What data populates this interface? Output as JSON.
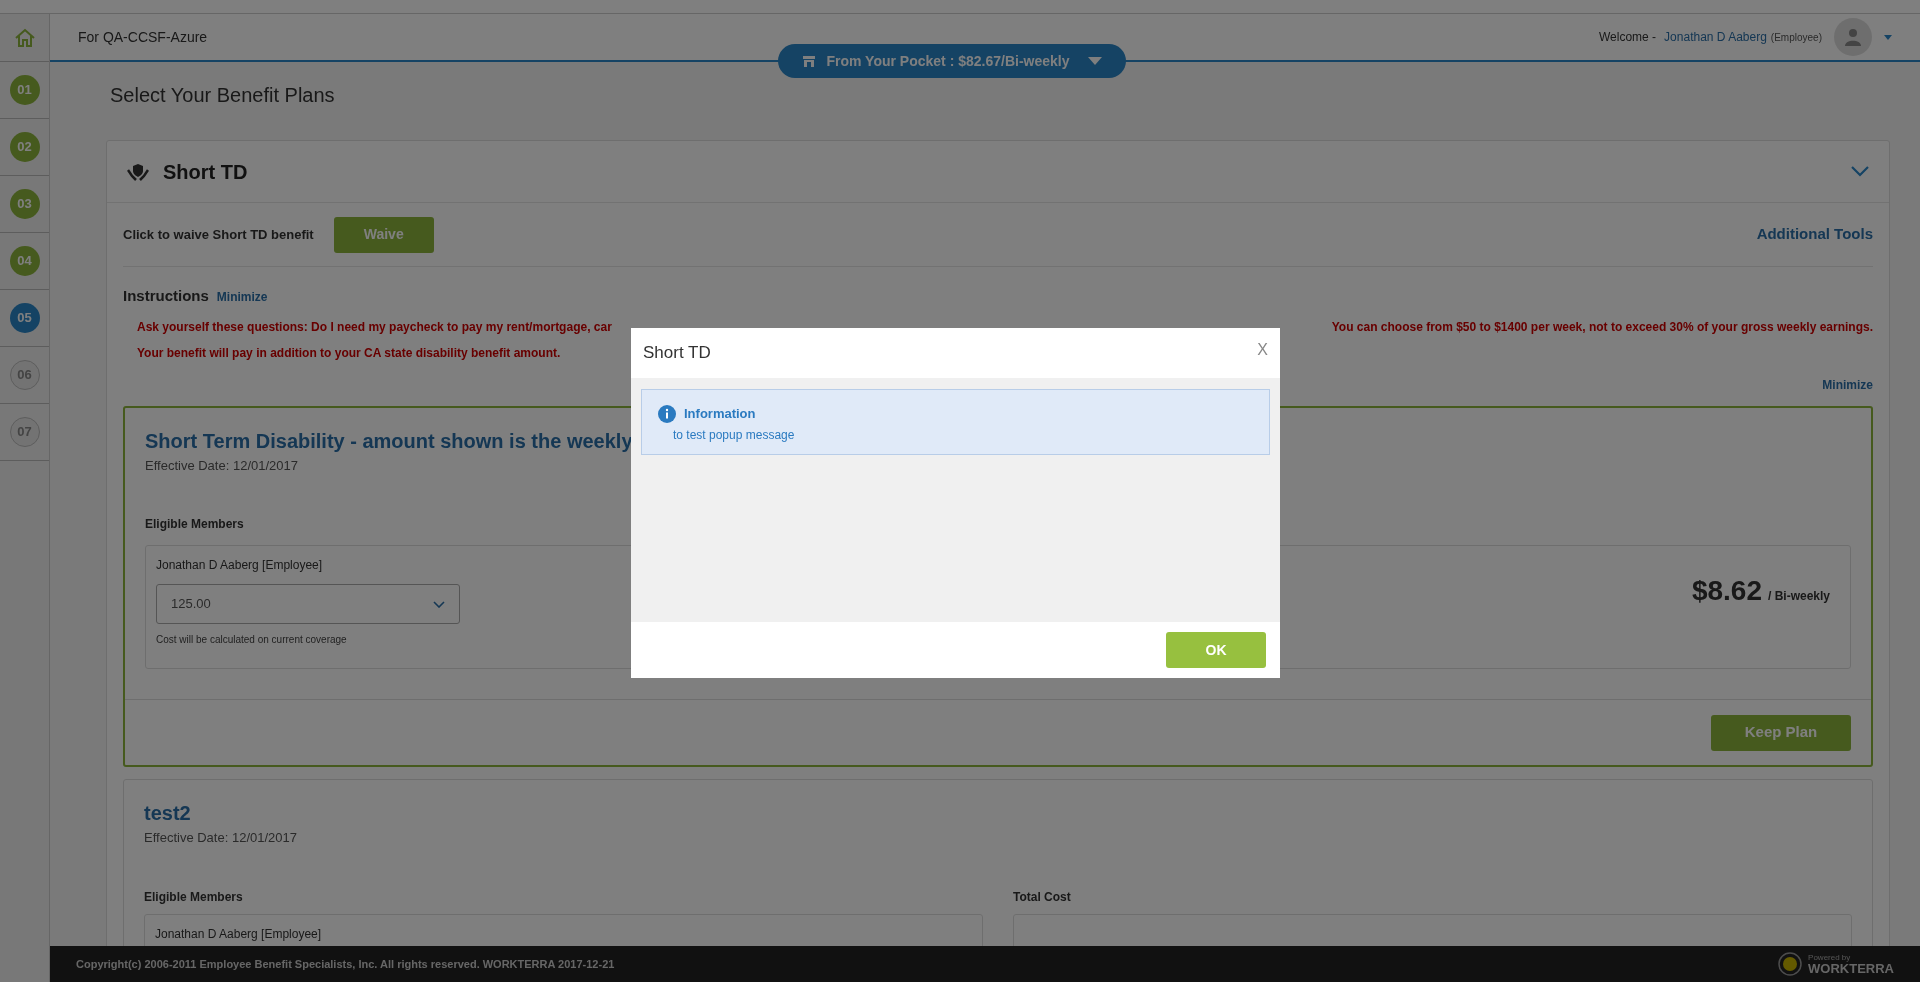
{
  "header": {
    "client": "For QA-CCSF-Azure",
    "pocket": "From Your Pocket : $82.67/Bi-weekly",
    "welcome": "Welcome -",
    "user": "Jonathan D Aaberg",
    "role": "(Employee)"
  },
  "steps": [
    {
      "label": "01",
      "completed": true,
      "selected": false
    },
    {
      "label": "02",
      "completed": true,
      "selected": false
    },
    {
      "label": "03",
      "completed": true,
      "selected": false
    },
    {
      "label": "04",
      "completed": true,
      "selected": false
    },
    {
      "label": "05",
      "completed": false,
      "selected": true
    },
    {
      "label": "06",
      "completed": false,
      "selected": false
    },
    {
      "label": "07",
      "completed": false,
      "selected": false
    }
  ],
  "page_title": "Select Your Benefit Plans",
  "benefit": {
    "title": "Short TD",
    "expanded": true,
    "waive_label": "Click to waive Short TD benefit",
    "waive_button": "Waive",
    "additional_tools": "Additional Tools",
    "instructions_label": "Instructions",
    "minimize": "Minimize",
    "instructions_line_1_start": "Ask yourself these questions:  Do I need my paycheck to pay my rent/mortgage, car",
    "instructions_line_1_end": "You can choose from $50 to $1400 per week, not to exceed 30% of your gross weekly earnings.",
    "instructions_line_2": "Your benefit will pay in addition to  your CA state disability benefit amount.",
    "minimize_right": "Minimize"
  },
  "plans": [
    {
      "title": "Short Term Disability - amount shown is the weekly",
      "selected": true,
      "effective": "Effective Date: 12/01/2017",
      "members_label": "Eligible Members",
      "member": "Jonathan D Aaberg [Employee]",
      "coverage": "125.00",
      "note": "Cost will be calculated on current coverage",
      "price": "$8.62",
      "period": "/ Bi-weekly",
      "button": "Keep Plan"
    },
    {
      "title": "test2",
      "selected": false,
      "effective": "Effective Date: 12/01/2017",
      "members_label": "Eligible Members",
      "member": "Jonathan D Aaberg [Employee]",
      "cost_label": "Total Cost"
    }
  ],
  "footer": {
    "copyright": "Copyright(c) 2006-2011 Employee Benefit Specialists, Inc. All rights reserved. WORKTERRA 2017-12-21",
    "powered_by": "Powered by",
    "brand": "WORKTERRA"
  },
  "dialog": {
    "title": "Short TD",
    "close": "X",
    "info_title": "Information",
    "info_text": "to test popup message",
    "ok": "OK"
  }
}
